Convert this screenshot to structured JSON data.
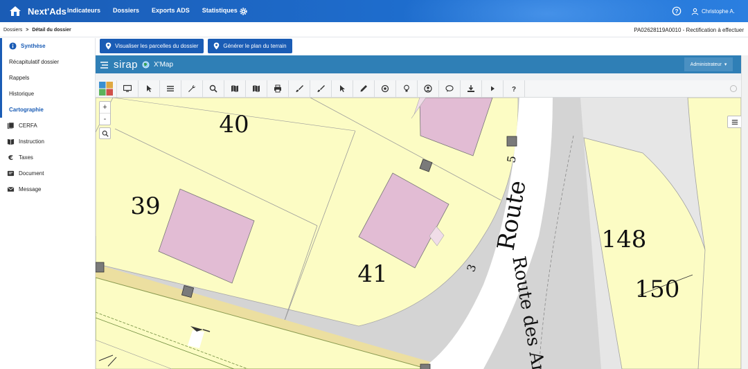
{
  "nav": {
    "brand": "Next'Ads",
    "links": [
      "Indicateurs",
      "Dossiers",
      "Exports ADS",
      "Statistiques"
    ],
    "user": "Christophe A.",
    "icons": [
      "home-icon",
      "gear-icon",
      "help-icon",
      "user-icon"
    ]
  },
  "breadcrumb": {
    "root": "Dossiers",
    "separator": ">",
    "current": "Détail du dossier"
  },
  "dossier_ref": "PA02628119A0010 - Rectification à effectuer",
  "sidebar": {
    "synthese": "Synthèse",
    "items": [
      "Récapitulatif dossier",
      "Rappels",
      "Historique"
    ],
    "cartographie": "Cartographie",
    "sections": [
      {
        "label": "CERFA",
        "icon": "forms-icon"
      },
      {
        "label": "Instruction",
        "icon": "book-icon"
      },
      {
        "label": "Taxes",
        "icon": "euro-icon"
      },
      {
        "label": "Document",
        "icon": "document-icon"
      },
      {
        "label": "Message",
        "icon": "envelope-icon"
      }
    ]
  },
  "actions": {
    "visualiser": "Visualiser les parcelles du dossier",
    "generer": "Générer le plan du terrain"
  },
  "xmap": {
    "logo": "sirap",
    "title": "X'Map",
    "admin": "Administrateur"
  },
  "map": {
    "parcels": [
      "40",
      "39",
      "41",
      "148",
      "150"
    ],
    "road_label": "Route",
    "road_label_2": "Route des Ar",
    "numbers": [
      "5",
      "3"
    ],
    "zoom_in": "+",
    "zoom_out": "-"
  },
  "colors": {
    "nav": "#1f6fd0",
    "accent": "#1a5cb5",
    "xmap_header": "#2f7fb6",
    "parcel": "#fcfcc4",
    "building": "#e2bcd4",
    "road": "#d4d4d4"
  }
}
